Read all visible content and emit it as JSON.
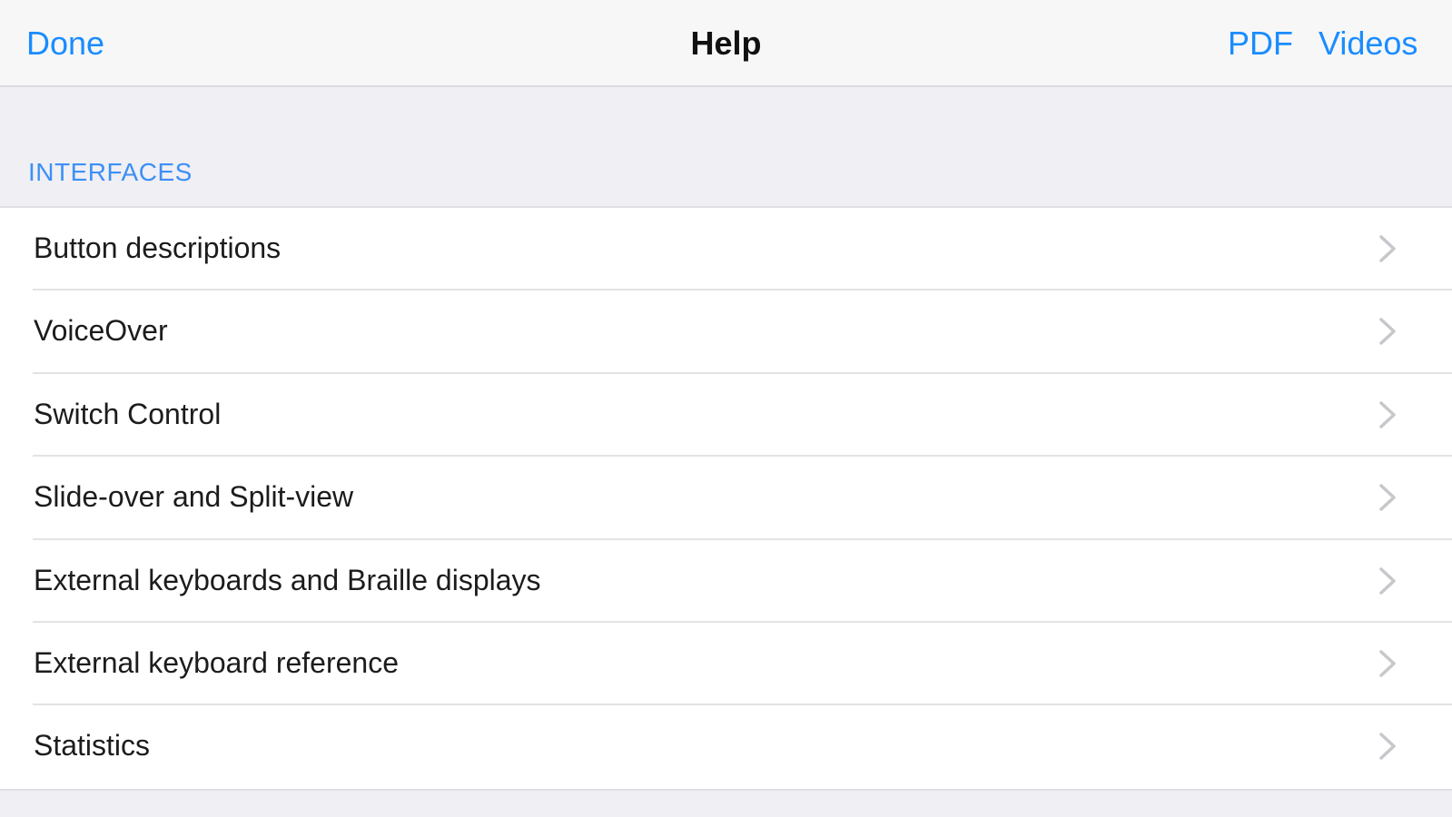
{
  "navbar": {
    "done_label": "Done",
    "title": "Help",
    "pdf_label": "PDF",
    "videos_label": "Videos"
  },
  "section": {
    "header": "INTERFACES",
    "items": [
      {
        "label": "Button descriptions",
        "icon": "chevron-right-icon"
      },
      {
        "label": "VoiceOver",
        "icon": "chevron-right-icon"
      },
      {
        "label": "Switch Control",
        "icon": "chevron-right-icon"
      },
      {
        "label": "Slide-over and Split-view",
        "icon": "chevron-right-icon"
      },
      {
        "label": "External keyboards and Braille displays",
        "icon": "chevron-right-icon"
      },
      {
        "label": "External keyboard reference",
        "icon": "chevron-right-icon"
      },
      {
        "label": "Statistics",
        "icon": "chevron-right-icon"
      }
    ]
  },
  "colors": {
    "accent": "#1a8cff",
    "background": "#efeff4",
    "row_background": "#ffffff",
    "chevron": "#c7c7cc"
  }
}
